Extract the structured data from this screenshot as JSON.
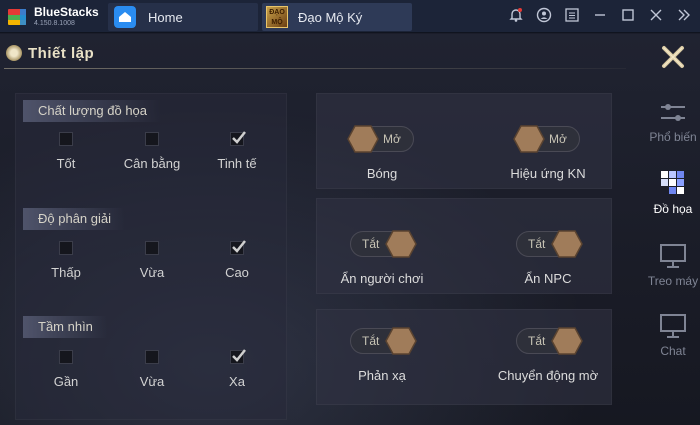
{
  "app": {
    "name": "BlueStacks",
    "version": "4.150.8.1008"
  },
  "tabs": [
    {
      "label": "Home"
    },
    {
      "label": "Đạo Mộ Ký",
      "icon_text": "ĐẠO MỘ"
    }
  ],
  "settings": {
    "title": "Thiết lập"
  },
  "graphics_quality": {
    "title": "Chất lượng đồ họa",
    "options": [
      {
        "label": "Tốt",
        "checked": false
      },
      {
        "label": "Cân bằng",
        "checked": false
      },
      {
        "label": "Tinh tế",
        "checked": true
      }
    ]
  },
  "resolution": {
    "title": "Độ phân giải",
    "options": [
      {
        "label": "Thấp",
        "checked": false
      },
      {
        "label": "Vừa",
        "checked": false
      },
      {
        "label": "Cao",
        "checked": true
      }
    ]
  },
  "view_distance": {
    "title": "Tầm nhìn",
    "options": [
      {
        "label": "Gần",
        "checked": false
      },
      {
        "label": "Vừa",
        "checked": false
      },
      {
        "label": "Xa",
        "checked": true
      }
    ]
  },
  "toggles": [
    {
      "label": "Bóng",
      "state": "Mở",
      "on": true
    },
    {
      "label": "Hiệu ứng KN",
      "state": "Mở",
      "on": true
    },
    {
      "label": "Ẩn người chơi",
      "state": "Tắt",
      "on": false
    },
    {
      "label": "Ẩn NPC",
      "state": "Tắt",
      "on": false
    },
    {
      "label": "Phản xạ",
      "state": "Tắt",
      "on": false
    },
    {
      "label": "Chuyển động mờ",
      "state": "Tắt",
      "on": false
    }
  ],
  "nav": [
    {
      "label": "Phổ biến",
      "icon": "sliders-icon"
    },
    {
      "label": "Đồ họa",
      "icon": "graphics-icon",
      "active": true
    },
    {
      "label": "Treo máy",
      "icon": "monitor-icon"
    },
    {
      "label": "Chat",
      "icon": "monitor-icon"
    }
  ],
  "colors": {
    "accent_gold": "#e8c46a",
    "knob": "#a07c5a",
    "bluestacks_blue": "#2a8cf0"
  }
}
